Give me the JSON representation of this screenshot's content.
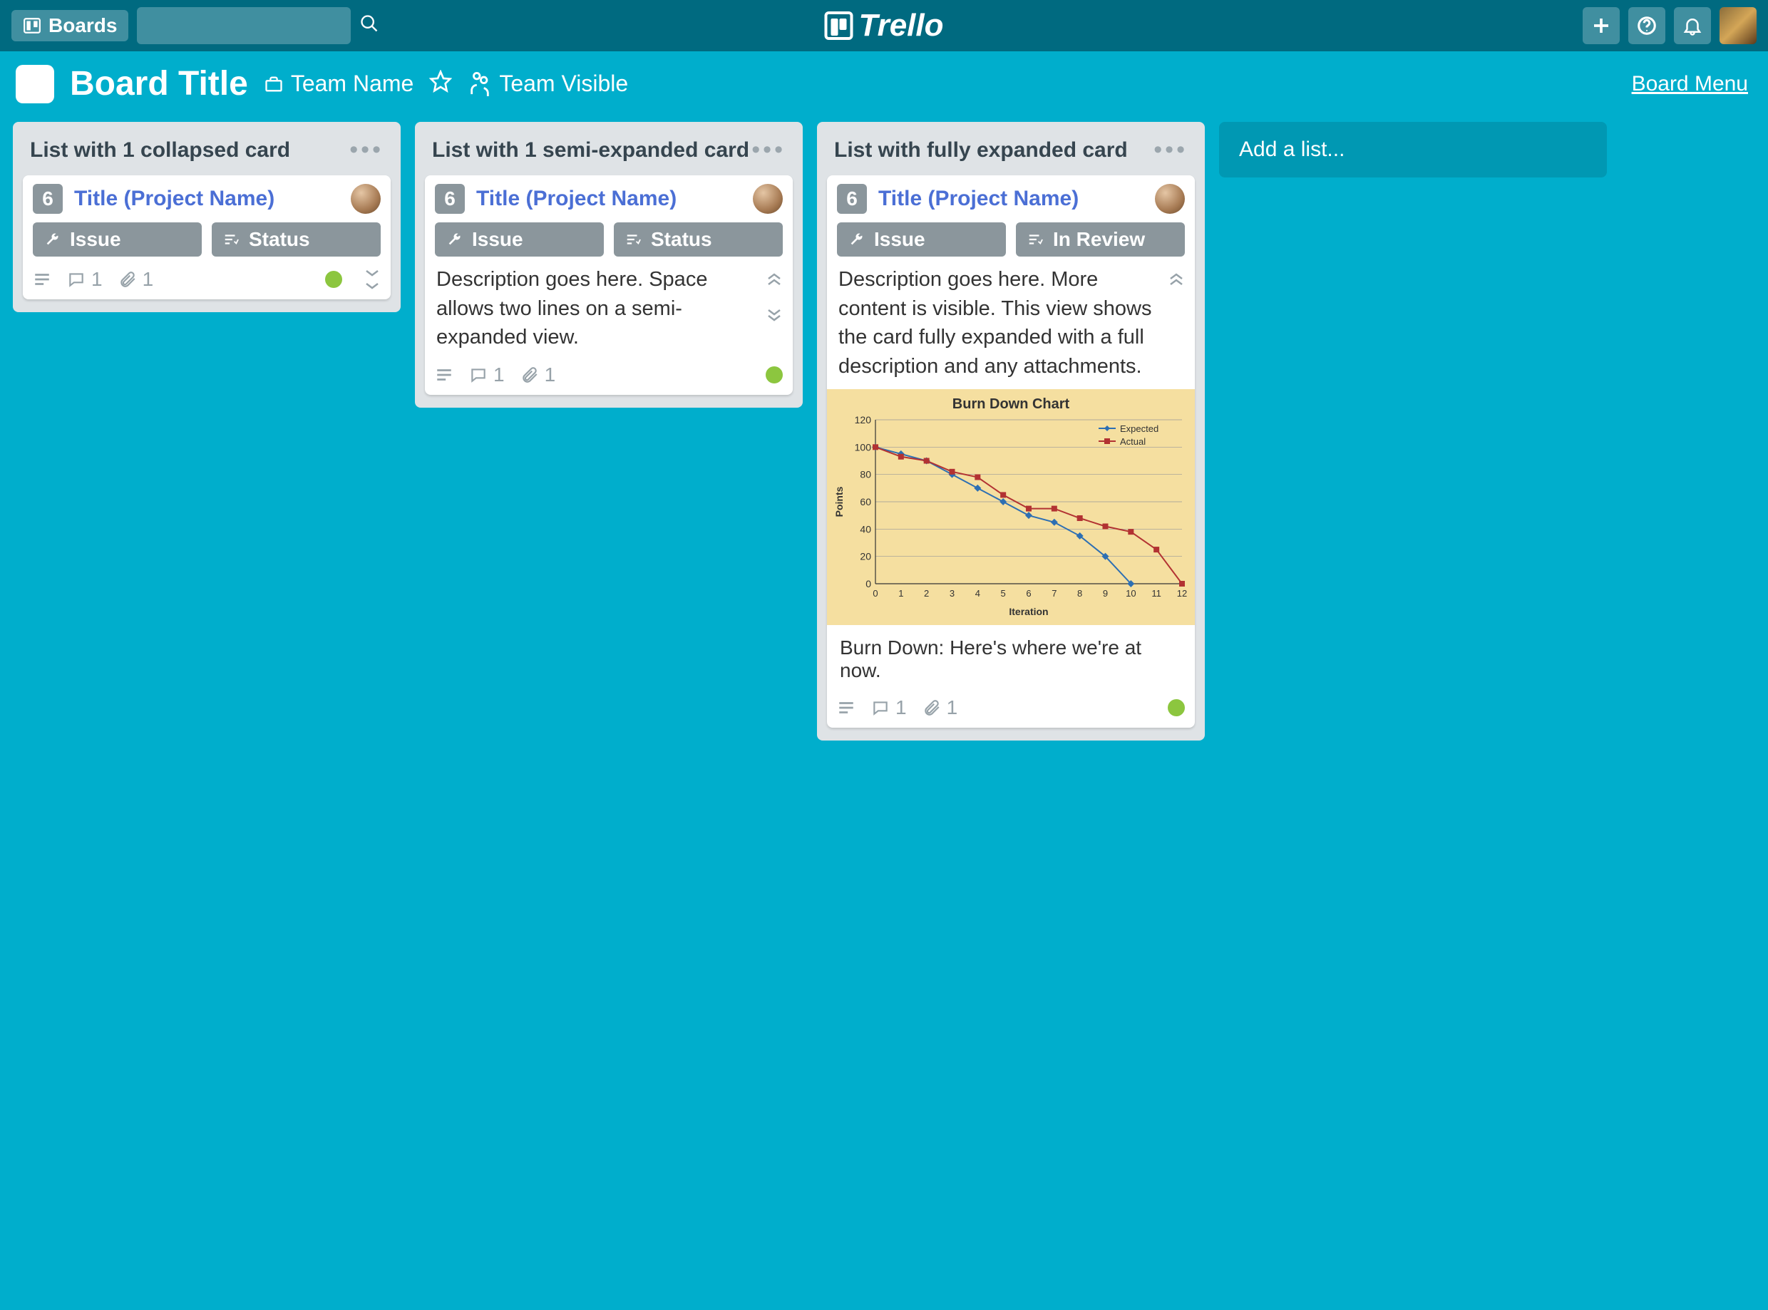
{
  "topbar": {
    "boards_label": "Boards",
    "logo_text": "Trello"
  },
  "boardbar": {
    "title": "Board Title",
    "team_name": "Team Name",
    "visibility": "Team Visible",
    "menu_link": "Board Menu"
  },
  "lists": [
    {
      "title": "List with 1 collapsed card",
      "card": {
        "count": "6",
        "title": "Title (Project Name)",
        "issue_label": "Issue",
        "status_label": "Status",
        "comments": "1",
        "attachments": "1"
      }
    },
    {
      "title": "List with 1 semi-expanded card",
      "card": {
        "count": "6",
        "title": "Title (Project Name)",
        "issue_label": "Issue",
        "status_label": "Status",
        "description": "Description goes here. Space allows two lines on a semi-expanded view.",
        "comments": "1",
        "attachments": "1"
      }
    },
    {
      "title": "List with fully expanded card",
      "card": {
        "count": "6",
        "title": "Title (Project Name)",
        "issue_label": "Issue",
        "status_label": "In Review",
        "description": "Description goes here. More content is visible. This view shows the card fully expanded with a full description and any attachments.",
        "attachment_caption": "Burn Down: Here's where we're at now.",
        "comments": "1",
        "attachments": "1"
      }
    }
  ],
  "add_list_label": "Add a list...",
  "chart_data": {
    "type": "line",
    "title": "Burn Down Chart",
    "xlabel": "Iteration",
    "ylabel": "Points",
    "xlim": [
      0,
      12
    ],
    "ylim": [
      0,
      120
    ],
    "yticks": [
      0,
      20,
      40,
      60,
      80,
      100,
      120
    ],
    "xticks": [
      0,
      1,
      2,
      3,
      4,
      5,
      6,
      7,
      8,
      9,
      10,
      11,
      12
    ],
    "series": [
      {
        "name": "Expected",
        "color": "#2D6FB3",
        "values": [
          100,
          95,
          90,
          80,
          70,
          60,
          50,
          45,
          35,
          20,
          0
        ]
      },
      {
        "name": "Actual",
        "color": "#B23232",
        "values": [
          100,
          93,
          90,
          82,
          78,
          65,
          55,
          55,
          48,
          42,
          38,
          25,
          0
        ]
      }
    ]
  }
}
